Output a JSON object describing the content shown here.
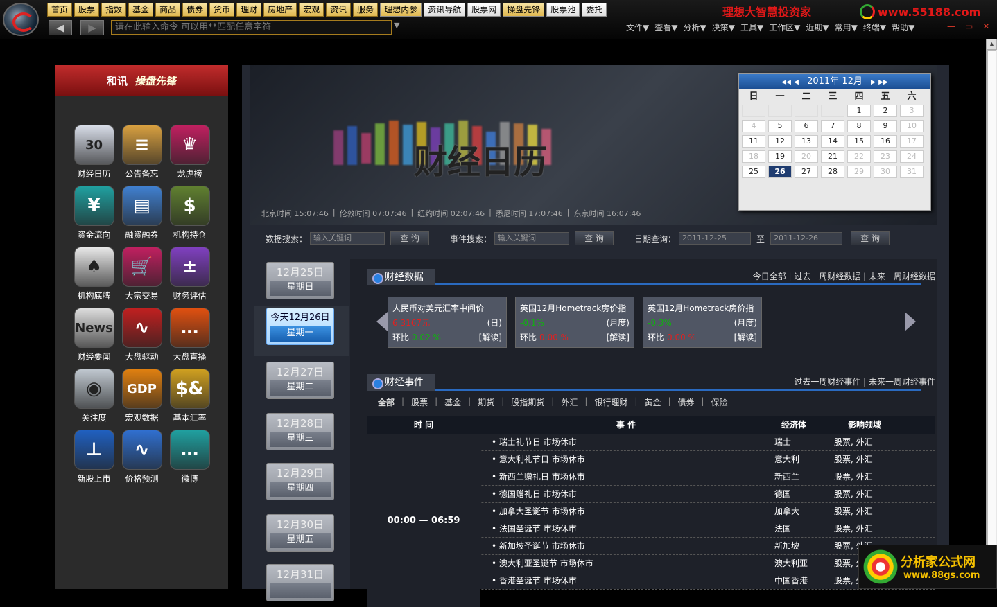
{
  "toolbar": {
    "buttons": [
      "首页",
      "股票",
      "指数",
      "基金",
      "商品",
      "债券",
      "货币",
      "理财",
      "房地产",
      "宏观",
      "资讯",
      "服务",
      "理想内参",
      "资讯导航",
      "股票网",
      "操盘先锋",
      "股票池",
      "委托"
    ],
    "brand": "理想大智慧投资家",
    "site": "www.55188.com",
    "command_placeholder": "请在此输入命令   可以用**匹配任意字符",
    "back": "◀",
    "forward": "▶",
    "menus": [
      "文件▼",
      "查看▼",
      "分析▼",
      "决策▼",
      "工具▼",
      "工作区▼",
      "近期▼",
      "常用▼",
      "终端▼",
      "帮助▼"
    ],
    "winctl": [
      "—",
      "▭",
      "✕"
    ]
  },
  "sidebar": {
    "brand": "和讯",
    "brand2": "操盘先锋",
    "items": [
      {
        "label": "财经日历",
        "icon": "calendar-icon",
        "glyph": "30",
        "color": "#d8dde8"
      },
      {
        "label": "公告备忘",
        "icon": "notebook-icon",
        "glyph": "≡",
        "color": "#d8a040"
      },
      {
        "label": "龙虎榜",
        "icon": "crown-icon",
        "glyph": "♛",
        "color": "#c02060"
      },
      {
        "label": "资金流向",
        "icon": "money-flow-icon",
        "glyph": "¥",
        "color": "#20a0a0"
      },
      {
        "label": "融资融券",
        "icon": "credit-card-icon",
        "glyph": "▤",
        "color": "#4080d0"
      },
      {
        "label": "机构持仓",
        "icon": "money-bag-icon",
        "glyph": "$",
        "color": "#608030"
      },
      {
        "label": "机构底牌",
        "icon": "spade-card-icon",
        "glyph": "♠",
        "color": "#e8e8e8"
      },
      {
        "label": "大宗交易",
        "icon": "cart-icon",
        "glyph": "🛒",
        "color": "#c02060"
      },
      {
        "label": "财务评估",
        "icon": "calculator-icon",
        "glyph": "±",
        "color": "#8040c0"
      },
      {
        "label": "财经要闻",
        "icon": "news-icon",
        "glyph": "News",
        "color": "#ddd"
      },
      {
        "label": "大盘驱动",
        "icon": "pulse-icon",
        "glyph": "∿",
        "color": "#c02020"
      },
      {
        "label": "大盘直播",
        "icon": "chat-bubble-icon",
        "glyph": "…",
        "color": "#e05010"
      },
      {
        "label": "关注度",
        "icon": "eye-icon",
        "glyph": "◉",
        "color": "#c0c8d0"
      },
      {
        "label": "宏观数据",
        "icon": "gdp-icon",
        "glyph": "GDP",
        "color": "#e08010"
      },
      {
        "label": "基本汇率",
        "icon": "currency-icon",
        "glyph": "$&",
        "color": "#d0a020"
      },
      {
        "label": "新股上市",
        "icon": "ipo-icon",
        "glyph": "⊥",
        "color": "#2060c0"
      },
      {
        "label": "价格预测",
        "icon": "wave-icon",
        "glyph": "∿",
        "color": "#3070d0"
      },
      {
        "label": "微博",
        "icon": "weibo-icon",
        "glyph": "…",
        "color": "#20a0a0"
      }
    ]
  },
  "banner": {
    "title": "财经日历",
    "times": [
      "北京时间 15:07:46",
      "|",
      "伦敦时间 07:07:46",
      "|",
      "纽约时间 02:07:46",
      "|",
      "悉尼时间 17:07:46",
      "|",
      "东京时间 16:07:46"
    ]
  },
  "calendar": {
    "title": "2011年 12月",
    "nav": [
      "◀◀",
      "◀",
      "▶",
      "▶▶"
    ],
    "weekdays": [
      "日",
      "一",
      "二",
      "三",
      "四",
      "五",
      "六"
    ],
    "days": [
      "",
      "",
      "",
      "",
      "1",
      "2",
      "3",
      "4",
      "5",
      "6",
      "7",
      "8",
      "9",
      "10",
      "11",
      "12",
      "13",
      "14",
      "15",
      "16",
      "17",
      "18",
      "19",
      "20",
      "21",
      "22",
      "23",
      "24",
      "25",
      "26",
      "27",
      "28",
      "29",
      "30",
      "31"
    ],
    "selected": "26"
  },
  "search": {
    "data_label": "数据搜索：",
    "data_placeholder": "输入关键词",
    "btn": "查 询",
    "event_label": "事件搜索：",
    "event_placeholder": "输入关键词",
    "date_label": "日期查询：",
    "date_from": "2011-12-25",
    "to": "至",
    "date_to": "2011-12-26"
  },
  "days": [
    {
      "date": "12月25日",
      "week": "星期日"
    },
    {
      "date": "今天12月26日",
      "week": "星期一",
      "today": true
    },
    {
      "date": "12月27日",
      "week": "星期二"
    },
    {
      "date": "12月28日",
      "week": "星期三"
    },
    {
      "date": "12月29日",
      "week": "星期四"
    },
    {
      "date": "12月30日",
      "week": "星期五"
    },
    {
      "date": "12月31日",
      "week": ""
    }
  ],
  "econ_data": {
    "title": "财经数据",
    "links": "今日全部  |  过去一周财经数据  |  未来一周财经数据",
    "cards": [
      {
        "name": "人民币对美元汇率中间价",
        "value": "6.3167元",
        "period": "(日)",
        "change_label": "环比",
        "change": "0.02 %",
        "read": "[解读]"
      },
      {
        "name": "英国12月Hometrack房价指",
        "value": "-0.1%",
        "period": "(月度)",
        "change_label": "环比",
        "change": "0.00 %",
        "read": "[解读]"
      },
      {
        "name": "英国12月Hometrack房价指",
        "value": "-0.3%",
        "period": "(月度)",
        "change_label": "环比",
        "change": "0.00 %",
        "read": "[解读]"
      }
    ]
  },
  "econ_events": {
    "title": "财经事件",
    "links": "过去一周财经事件  |  未来一周财经事件",
    "tabs": [
      "全部",
      "股票",
      "基金",
      "期货",
      "股指期货",
      "外汇",
      "银行理财",
      "黄金",
      "债券",
      "保险"
    ],
    "headers": [
      "时 间",
      "事 件",
      "经济体",
      "影响领域"
    ],
    "time": "00:00 — 06:59",
    "rows": [
      {
        "event": "瑞士礼节日 市场休市",
        "economy": "瑞士",
        "impact": "股票, 外汇"
      },
      {
        "event": "意大利礼节日 市场休市",
        "economy": "意大利",
        "impact": "股票, 外汇"
      },
      {
        "event": "新西兰赠礼日 市场休市",
        "economy": "新西兰",
        "impact": "股票, 外汇"
      },
      {
        "event": "德国赠礼日 市场休市",
        "economy": "德国",
        "impact": "股票, 外汇"
      },
      {
        "event": "加拿大圣诞节 市场休市",
        "economy": "加拿大",
        "impact": "股票, 外汇"
      },
      {
        "event": "法国圣诞节 市场休市",
        "economy": "法国",
        "impact": "股票, 外汇"
      },
      {
        "event": "新加坡圣诞节 市场休市",
        "economy": "新加坡",
        "impact": "股票, 外汇"
      },
      {
        "event": "澳大利亚圣诞节 市场休市",
        "economy": "澳大利亚",
        "impact": "股票, 外汇"
      },
      {
        "event": "香港圣诞节 市场休市",
        "economy": "中国香港",
        "impact": "股票, 外汇"
      }
    ]
  },
  "ad": {
    "title": "分析家公式网",
    "url": "www.88gs.com"
  }
}
